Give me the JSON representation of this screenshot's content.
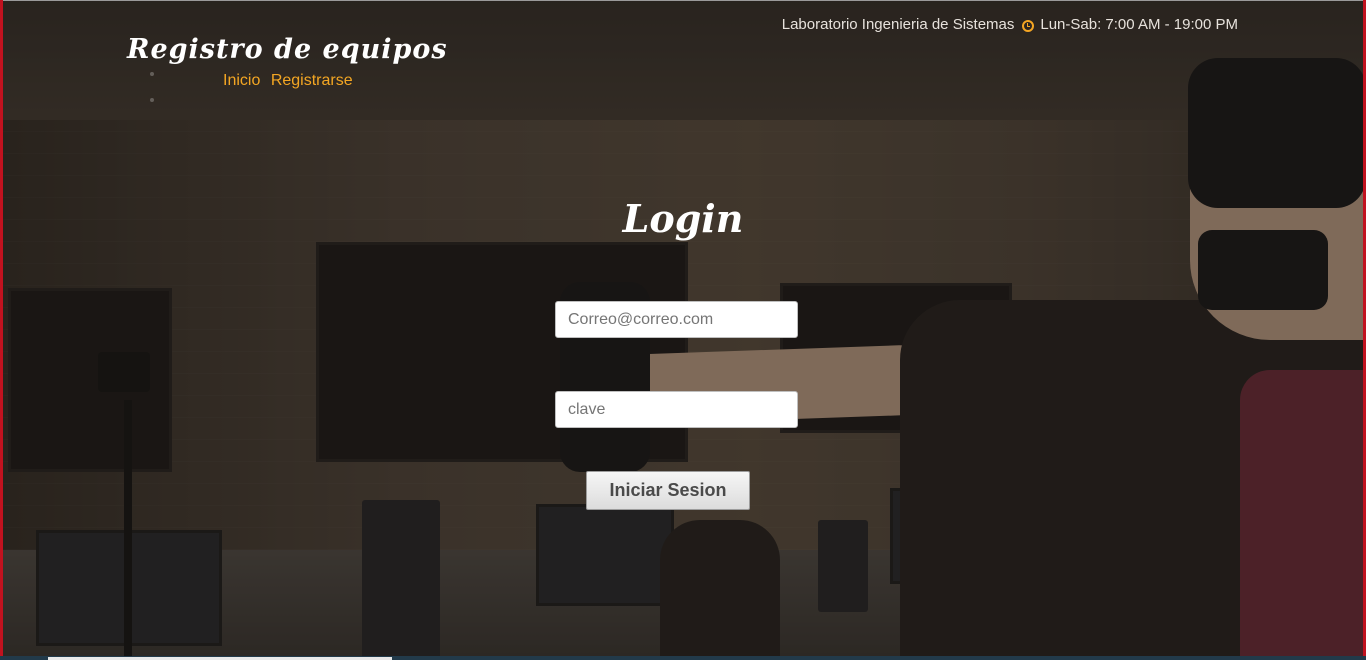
{
  "header": {
    "brand": "Registro de equipos",
    "nav": [
      {
        "label": "Inicio"
      },
      {
        "label": "Registrarse"
      }
    ],
    "info_lab": "Laboratorio Ingenieria de Sistemas",
    "info_hours": "Lun-Sab: 7:00 AM - 19:00 PM",
    "info_icon": "clock-icon"
  },
  "login": {
    "title": "Login",
    "email_placeholder": "Correo@correo.com",
    "password_placeholder": "clave",
    "submit_label": "Iniciar Sesion"
  },
  "colors": {
    "accent": "#f4a623",
    "edge": "#c1121f"
  }
}
